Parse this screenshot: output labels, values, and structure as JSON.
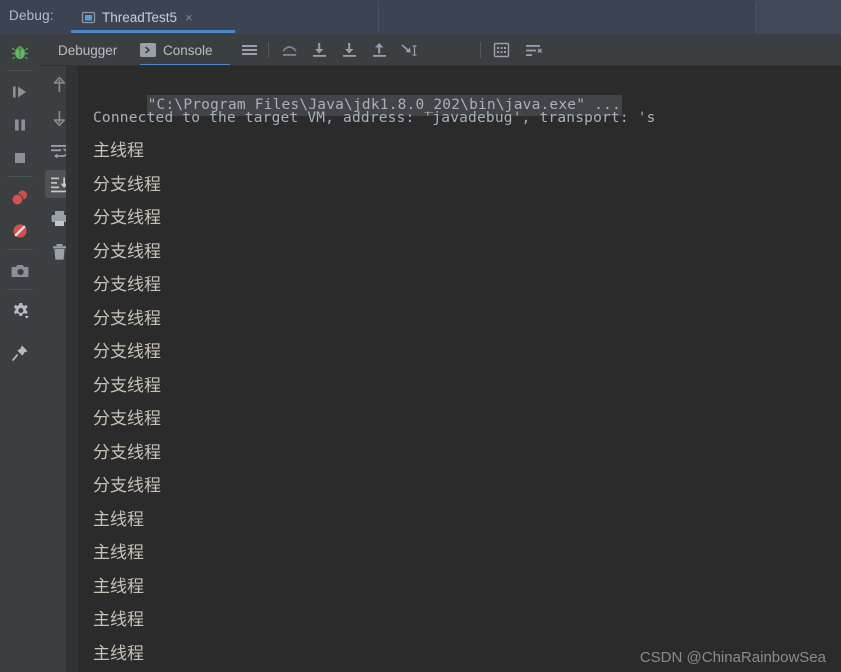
{
  "titlebar": {
    "label": "Debug:",
    "tab": {
      "name": "ThreadTest5",
      "icon": "run-config-icon",
      "close": "×"
    }
  },
  "tabs": [
    {
      "id": "debugger",
      "label": "Debugger",
      "selected": false,
      "icon": null
    },
    {
      "id": "console",
      "label": "Console",
      "selected": true,
      "icon": "console-prompt-icon"
    }
  ],
  "toolbar_icons": [
    {
      "name": "layout-lines-icon",
      "title": "Layout"
    },
    {
      "name": "step-over-icon",
      "title": "Step Over"
    },
    {
      "name": "step-into-icon",
      "title": "Step Into"
    },
    {
      "name": "force-step-into-icon",
      "title": "Force Step Into"
    },
    {
      "name": "step-out-icon",
      "title": "Step Out"
    },
    {
      "name": "run-to-cursor-icon",
      "title": "Run to Cursor"
    },
    {
      "name": "evaluate-expression-icon",
      "title": "Evaluate Expression"
    },
    {
      "name": "mute-breakpoints-icon",
      "title": "Settings"
    }
  ],
  "left_strip_icons": [
    {
      "name": "debug-bug-icon",
      "title": "Debug",
      "color": "#5cb85c"
    },
    {
      "name": "resume-program-icon",
      "title": "Resume Program",
      "color": "#8b9098"
    },
    {
      "name": "pause-program-icon",
      "title": "Pause Program",
      "color": "#8b9098"
    },
    {
      "name": "stop-icon",
      "title": "Stop",
      "color": "#8b9098"
    },
    {
      "name": "view-breakpoints-icon",
      "title": "View Breakpoints",
      "color": "#d0524f"
    },
    {
      "name": "mute-breakpoints-icon",
      "title": "Mute Breakpoints",
      "color": "#d0524f"
    },
    {
      "name": "camera-snapshot-icon",
      "title": "Get Thread Dump",
      "color": "#8b9098"
    },
    {
      "name": "settings-gear-icon",
      "title": "Settings",
      "color": "#b6bbc4"
    },
    {
      "name": "pin-tab-icon",
      "title": "Pin Tab",
      "color": "#b6bbc4"
    }
  ],
  "console_strip_icons": [
    {
      "name": "scroll-up-icon",
      "title": "Up the Stack Trace",
      "selected": false
    },
    {
      "name": "scroll-down-icon",
      "title": "Down the Stack Trace",
      "selected": false
    },
    {
      "name": "soft-wrap-icon",
      "title": "Use Soft Wraps",
      "selected": false
    },
    {
      "name": "scroll-to-end-icon",
      "title": "Scroll to the End",
      "selected": true
    },
    {
      "name": "print-icon",
      "title": "Print",
      "selected": false
    },
    {
      "name": "clear-all-icon",
      "title": "Clear All",
      "selected": false
    }
  ],
  "console": {
    "command_line": "\"C:\\Program Files\\Java\\jdk1.8.0_202\\bin\\java.exe\" ...",
    "connected_line": "Connected to the target VM, address: 'javadebug', transport: 's",
    "output_lines": [
      "主线程",
      "分支线程",
      "分支线程",
      "分支线程",
      "分支线程",
      "分支线程",
      "分支线程",
      "分支线程",
      "分支线程",
      "分支线程",
      "分支线程",
      "主线程",
      "主线程",
      "主线程",
      "主线程",
      "主线程"
    ]
  },
  "watermark": "CSDN @ChinaRainbowSea",
  "colors": {
    "titlebar_bg": "#3c4453",
    "panel_bg": "#3c3f41",
    "console_bg": "#2b2b2b",
    "accent_blue": "#4a88c7",
    "output_text": "#c9c2b7",
    "mono_text": "#a9b0bb",
    "string_text": "#9d8a6f"
  }
}
